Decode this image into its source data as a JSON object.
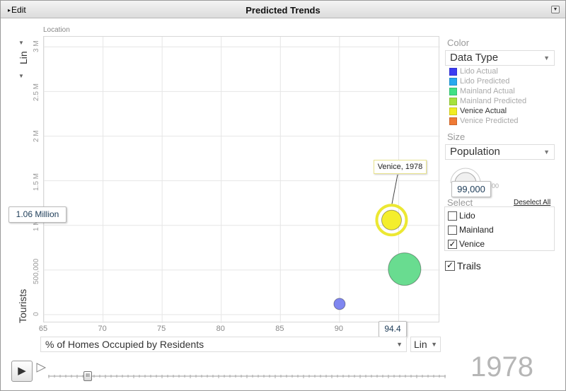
{
  "header": {
    "edit_label": "Edit",
    "title": "Predicted Trends"
  },
  "chart_data": {
    "type": "scatter",
    "y_axis_label": "Location",
    "y_axis_title": "Tourists",
    "y_scale": "Lin",
    "x_axis_title": "% of Homes Occupied by Residents",
    "x_scale": "Lin",
    "x_ticks": [
      "65",
      "70",
      "75",
      "80",
      "85",
      "90",
      "95"
    ],
    "y_ticks": [
      "0",
      "500,000",
      "1 M",
      "1.5 M",
      "2 M",
      "2.5 M",
      "3 M"
    ],
    "xlim": [
      65,
      98.5
    ],
    "ylim": [
      0,
      3050000
    ],
    "points": [
      {
        "label": "Lido",
        "x": 90,
        "y": 120000,
        "size": 16,
        "color": "#7f86f0",
        "selected": false
      },
      {
        "label": "Mainland",
        "x": 95.5,
        "y": 510000,
        "size": 46,
        "color": "#69dc90",
        "selected": false
      },
      {
        "label": "Venice",
        "x": 94.4,
        "y": 1060000,
        "size": 28,
        "color": "#f4ee2c",
        "selected": true
      }
    ],
    "grid": true
  },
  "markers": {
    "y_value": "1.06 Million",
    "x_value": "94.4"
  },
  "tooltip": "Venice, 1978",
  "controls": {
    "year": "1978",
    "play_icon": "play-icon",
    "color_label": "Color",
    "color_select": "Data Type",
    "legend": [
      {
        "label": "Lido Actual",
        "color": "#3c3cf2",
        "active": false
      },
      {
        "label": "Lido Predicted",
        "color": "#27a9ef",
        "active": false
      },
      {
        "label": "Mainland Actual",
        "color": "#3fe184",
        "active": false
      },
      {
        "label": "Mainland Predicted",
        "color": "#a6e23d",
        "active": false
      },
      {
        "label": "Venice Actual",
        "color": "#f1ed22",
        "active": true
      },
      {
        "label": "Venice Predicted",
        "color": "#ef7a35",
        "active": false
      }
    ],
    "size_label": "Size",
    "size_select": "Population",
    "size_value": "99,000",
    "size_tail": "00",
    "select_label": "Select",
    "deselect_all": "Deselect All",
    "select_items": [
      {
        "label": "Lido",
        "checked": false
      },
      {
        "label": "Mainland",
        "checked": false
      },
      {
        "label": "Venice",
        "checked": true
      }
    ],
    "trails_label": "Trails",
    "trails_checked": true
  }
}
